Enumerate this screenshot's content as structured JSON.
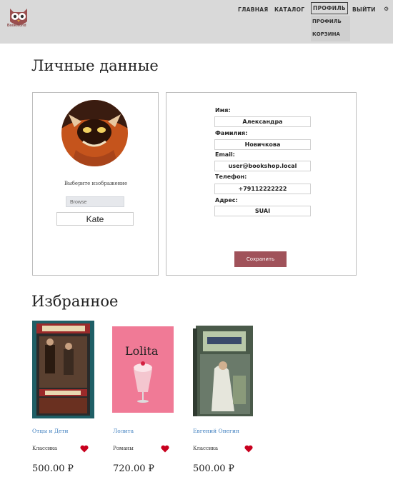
{
  "brand": {
    "logo_text": "BookWorld"
  },
  "nav": {
    "items": [
      "ГЛАВНАЯ",
      "КАТАЛОГ",
      "ПРОФИЛЬ",
      "ВЫЙТИ"
    ],
    "dropdown": [
      "ПРОФИЛЬ",
      "КОРЗИНА"
    ]
  },
  "personal": {
    "title": "Личные данные",
    "choose_image": "Выберите изображение",
    "browse": "Browse",
    "username": "Kate"
  },
  "form": {
    "fields": [
      {
        "label": "Имя:",
        "value": "Александра"
      },
      {
        "label": "Фамилия:",
        "value": "Новичкова"
      },
      {
        "label": "Email:",
        "value": "user@bookshop.local"
      },
      {
        "label": "Телефон:",
        "value": "+79112222222"
      },
      {
        "label": "Адрес:",
        "value": "SUAI"
      }
    ],
    "save": "Сохранить"
  },
  "favorites": {
    "title": "Избранное",
    "books": [
      {
        "title": "Отцы и Дети",
        "genre": "Классика",
        "price": "500.00 ₽"
      },
      {
        "title": "Лолита",
        "genre": "Романы",
        "price": "720.00 ₽"
      },
      {
        "title": "Евгений Онегин",
        "genre": "Классика",
        "price": "500.00 ₽"
      }
    ]
  },
  "colors": {
    "header_bg": "#d9d9d9",
    "save_button": "#a0525a",
    "heart": "#c8001e",
    "link": "#3f7fbf"
  }
}
